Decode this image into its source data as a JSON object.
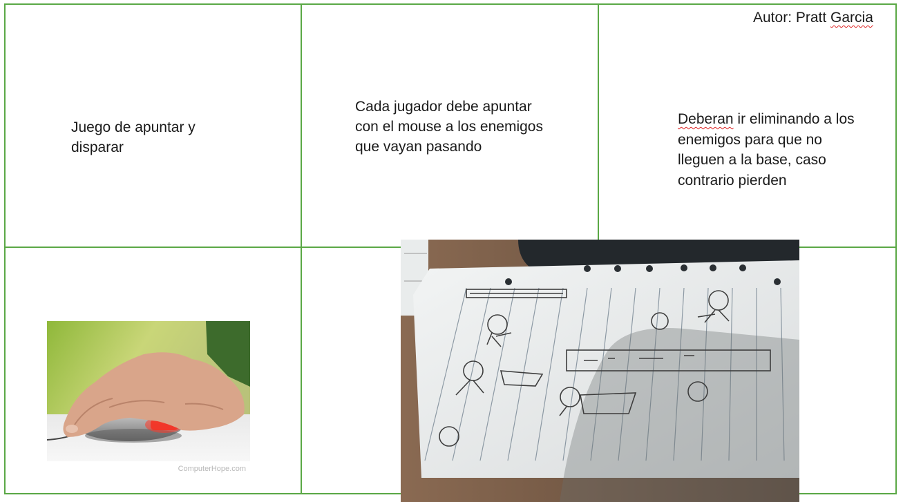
{
  "slide": {
    "author_prefix": "Autor: Pratt ",
    "author_flagged": "Garcia",
    "cells": [
      {
        "text": "Juego de apuntar y disparar"
      },
      {
        "text": "Cada jugador debe apuntar con el mouse a los enemigos que vayan pasando"
      },
      {
        "flagged_word": "Deberan",
        "text_rest": " ir eliminando a los enemigos para que no lleguen a la base, caso contrario pierden"
      }
    ],
    "mouse_image": {
      "caption": "ComputerHope.com"
    },
    "colors": {
      "grid": "#5aa845",
      "spellcheck": "#d22222"
    },
    "sketch_image": {
      "icon": "stick-figure-sketch-photo"
    }
  }
}
